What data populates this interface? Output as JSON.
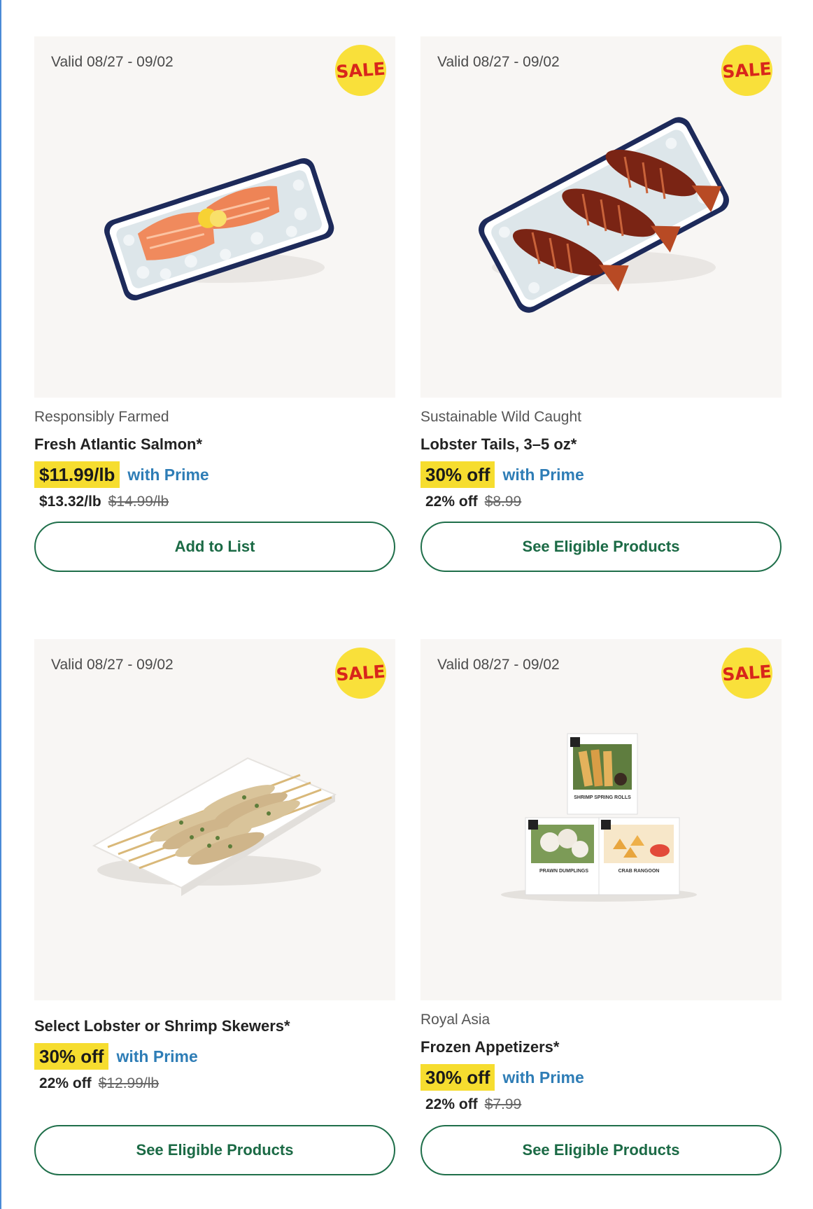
{
  "sale_badge_text": "SALE",
  "accent_green": "#1f6f4a",
  "prime_blue": "#2e7db6",
  "highlight_yellow": "#f6dd2f",
  "cards": [
    {
      "valid": "Valid 08/27 - 09/02",
      "eyebrow": "Responsibly Farmed",
      "title": "Fresh Atlantic Salmon*",
      "prime_price": "$11.99/lb",
      "prime_label": "with Prime",
      "regular_price": "$13.32/lb",
      "original_price": "$14.99/lb",
      "button": "Add to List",
      "image_icon": "salmon-tray-image"
    },
    {
      "valid": "Valid 08/27 - 09/02",
      "eyebrow": "Sustainable Wild Caught",
      "title": "Lobster Tails, 3–5 oz*",
      "prime_price": "30% off",
      "prime_label": "with Prime",
      "regular_price": "22% off",
      "original_price": "$8.99",
      "button": "See Eligible Products",
      "image_icon": "lobster-tails-image"
    },
    {
      "valid": "Valid 08/27 - 09/02",
      "eyebrow": "",
      "title": "Select Lobster or Shrimp Skewers*",
      "prime_price": "30% off",
      "prime_label": "with Prime",
      "regular_price": "22% off",
      "original_price": "$12.99/lb",
      "button": "See Eligible Products",
      "image_icon": "skewers-image"
    },
    {
      "valid": "Valid 08/27 - 09/02",
      "eyebrow": "Royal Asia",
      "title": "Frozen Appetizers*",
      "prime_price": "30% off",
      "prime_label": "with Prime",
      "regular_price": "22% off",
      "original_price": "$7.99",
      "button": "See Eligible Products",
      "image_icon": "frozen-appetizers-image",
      "box_labels": [
        "SHRIMP SPRING ROLLS",
        "PRAWN DUMPLINGS",
        "CRAB RANGOON"
      ]
    }
  ]
}
